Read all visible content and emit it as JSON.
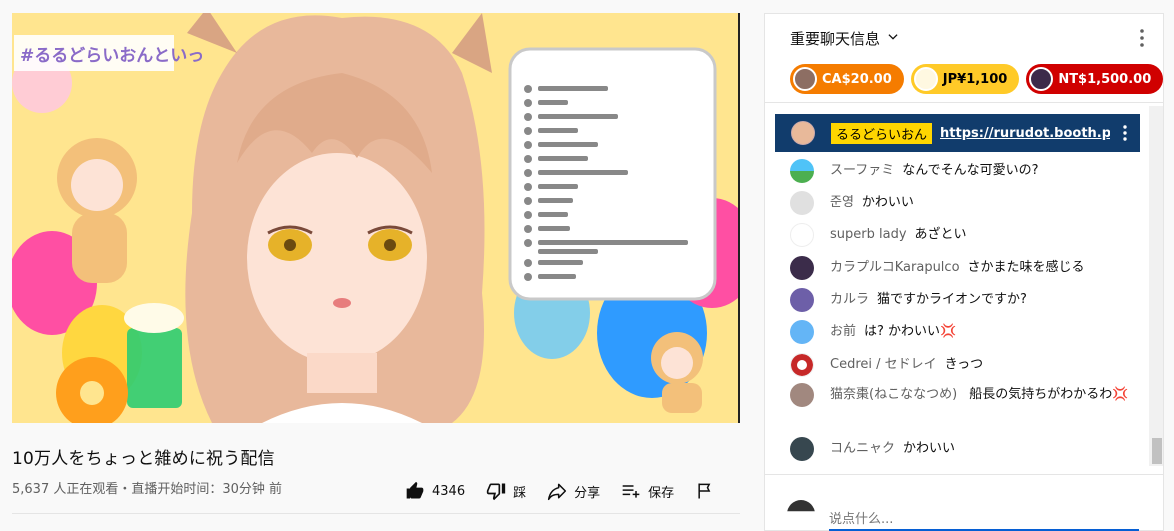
{
  "video": {
    "overlay_hashtag": "#るるどらいおんといっ",
    "title": "10万人をちょっと雑めに祝う配信",
    "meta": "5,637 人正在观看・直播开始时间：30分钟 前"
  },
  "actions": {
    "like_count": "4346",
    "dislike_label": "踩",
    "share_label": "分享",
    "save_label": "保存"
  },
  "chat": {
    "header_title": "重要聊天信息",
    "tickers": [
      {
        "amount": "CA$20.00",
        "color": "#f57c00"
      },
      {
        "amount": "JP¥1,100",
        "color": "#ffca28"
      },
      {
        "amount": "NT$1,500.00",
        "color": "#d00000"
      }
    ],
    "pinned": {
      "author": "るるどらいおん",
      "link": "https://rurudot.booth.pm/i..."
    },
    "messages": [
      {
        "name": "スーファミ",
        "text": "なんでそんな可愛いの?",
        "avatar_color": "#4caf50"
      },
      {
        "name": "준영",
        "text": "かわいい",
        "avatar_color": "#e0e0e0"
      },
      {
        "name": "superb lady",
        "text": "あざとい",
        "avatar_color": "#ffffff"
      },
      {
        "name": "カラプルコKarapulco",
        "text": "さかまた味を感じる",
        "avatar_color": "#3b2c4a"
      },
      {
        "name": "カルラ",
        "text": "猫ですかライオンですか?",
        "avatar_color": "#6d5fa8"
      },
      {
        "name": "お前",
        "text": "は? かわいい💢",
        "avatar_color": "#64b5f6"
      },
      {
        "name": "Cedrei / セドレイ",
        "text": "きっつ",
        "avatar_color": "#c62828"
      },
      {
        "name": "猫奈棗(ねこななつめ)",
        "text": "船長の気持ちがわかるわ💢",
        "avatar_color": "#a1887f"
      },
      {
        "name": "コんニャク",
        "text": "かわいい",
        "avatar_color": "#37474f"
      }
    ],
    "input_placeholder": "说点什么..."
  }
}
